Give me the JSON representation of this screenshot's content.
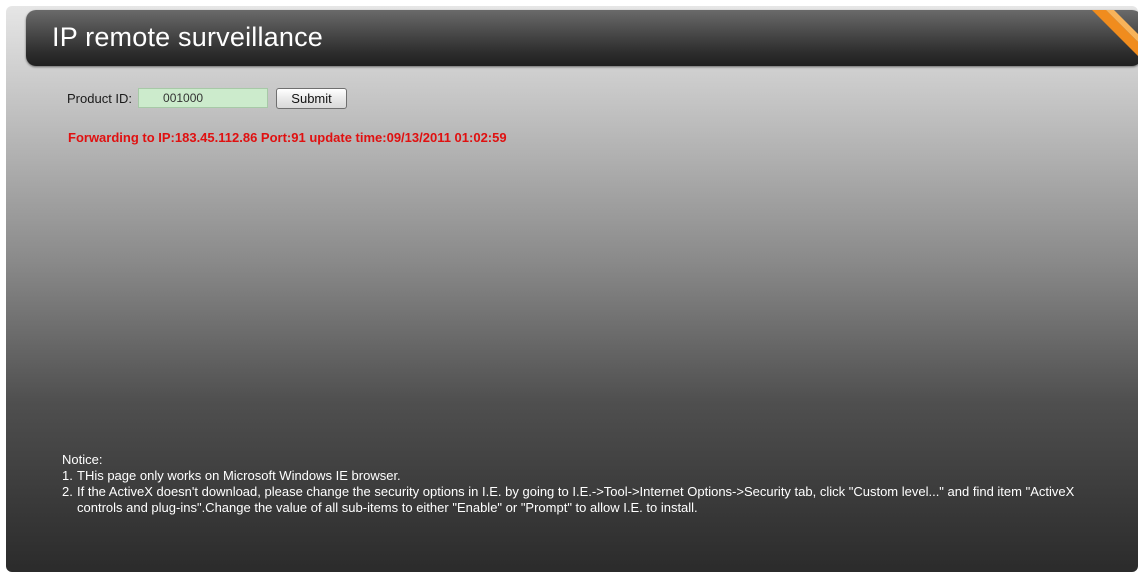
{
  "header": {
    "title": "IP remote surveillance"
  },
  "form": {
    "product_id_label": "Product ID:",
    "product_id_value": "001000",
    "submit_label": "Submit"
  },
  "status": {
    "forwarding_message": "Forwarding to IP:183.45.112.86 Port:91 update time:09/13/2011 01:02:59"
  },
  "notice": {
    "heading": "Notice:",
    "items": [
      {
        "num": "1.",
        "text": "THis page only works on Microsoft Windows IE browser."
      },
      {
        "num": "2.",
        "text": "If the ActiveX doesn't download, please change the security options in I.E. by going to I.E.->Tool->Internet Options->Security tab, click \"Custom level...\" and find item \"ActiveX controls and plug-ins\".Change the value of all sub-items to either \"Enable\" or \"Prompt\" to allow I.E. to install."
      }
    ]
  },
  "colors": {
    "title_text": "#ffffff",
    "forward_message": "#e01010",
    "input_bg": "#ccebcc",
    "ribbon": "#f08c1e"
  },
  "icons": {
    "corner": "orange-corner-ribbon-icon"
  }
}
